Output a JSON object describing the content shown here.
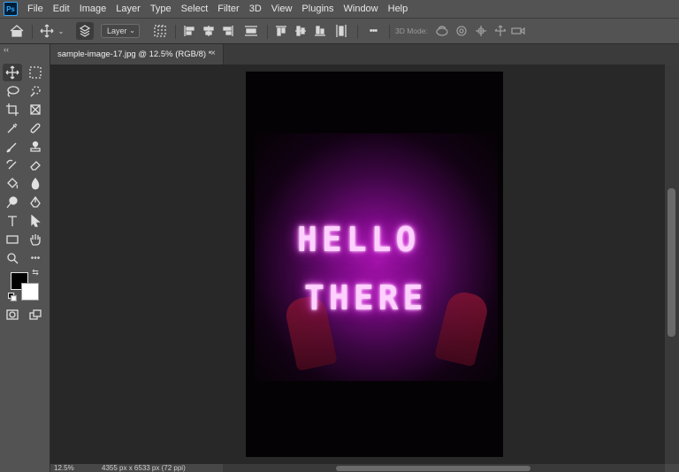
{
  "app": {
    "logo": "Ps"
  },
  "menu": [
    "File",
    "Edit",
    "Image",
    "Layer",
    "Type",
    "Select",
    "Filter",
    "3D",
    "View",
    "Plugins",
    "Window",
    "Help"
  ],
  "options": {
    "layer_select": "Layer",
    "mode_label": "3D Mode:",
    "more": "•••"
  },
  "document": {
    "tab_title": "sample-image-17.jpg @ 12.5% (RGB/8) *",
    "close": "×",
    "neon_line1": "HELLO",
    "neon_line2": "THERE"
  },
  "status": {
    "zoom": "12.5%",
    "dimensions": "4355 px x 6533 px (72 ppi)"
  },
  "colors": {
    "foreground": "#000000",
    "background": "#ffffff",
    "neon": "#ff6cff"
  },
  "icons": [
    "home-icon",
    "move-icon",
    "auto-select-icon",
    "grid-icon",
    "align-left-icon",
    "align-center-icon",
    "align-right-icon",
    "distribute-icon",
    "more-icon",
    "orbit-icon",
    "roll-icon",
    "pan-icon",
    "slide-icon",
    "scale-icon",
    "marquee-icon",
    "lasso-icon",
    "quick-select-icon",
    "crop-icon",
    "frame-icon",
    "eyedropper-icon",
    "healing-icon",
    "brush-icon",
    "stamp-icon",
    "history-brush-icon",
    "eraser-icon",
    "bucket-icon",
    "blur-icon",
    "dodge-icon",
    "pen-icon",
    "type-icon",
    "path-select-icon",
    "rectangle-icon",
    "hand-icon",
    "zoom-icon",
    "quickmask-icon",
    "screenmode-icon"
  ]
}
